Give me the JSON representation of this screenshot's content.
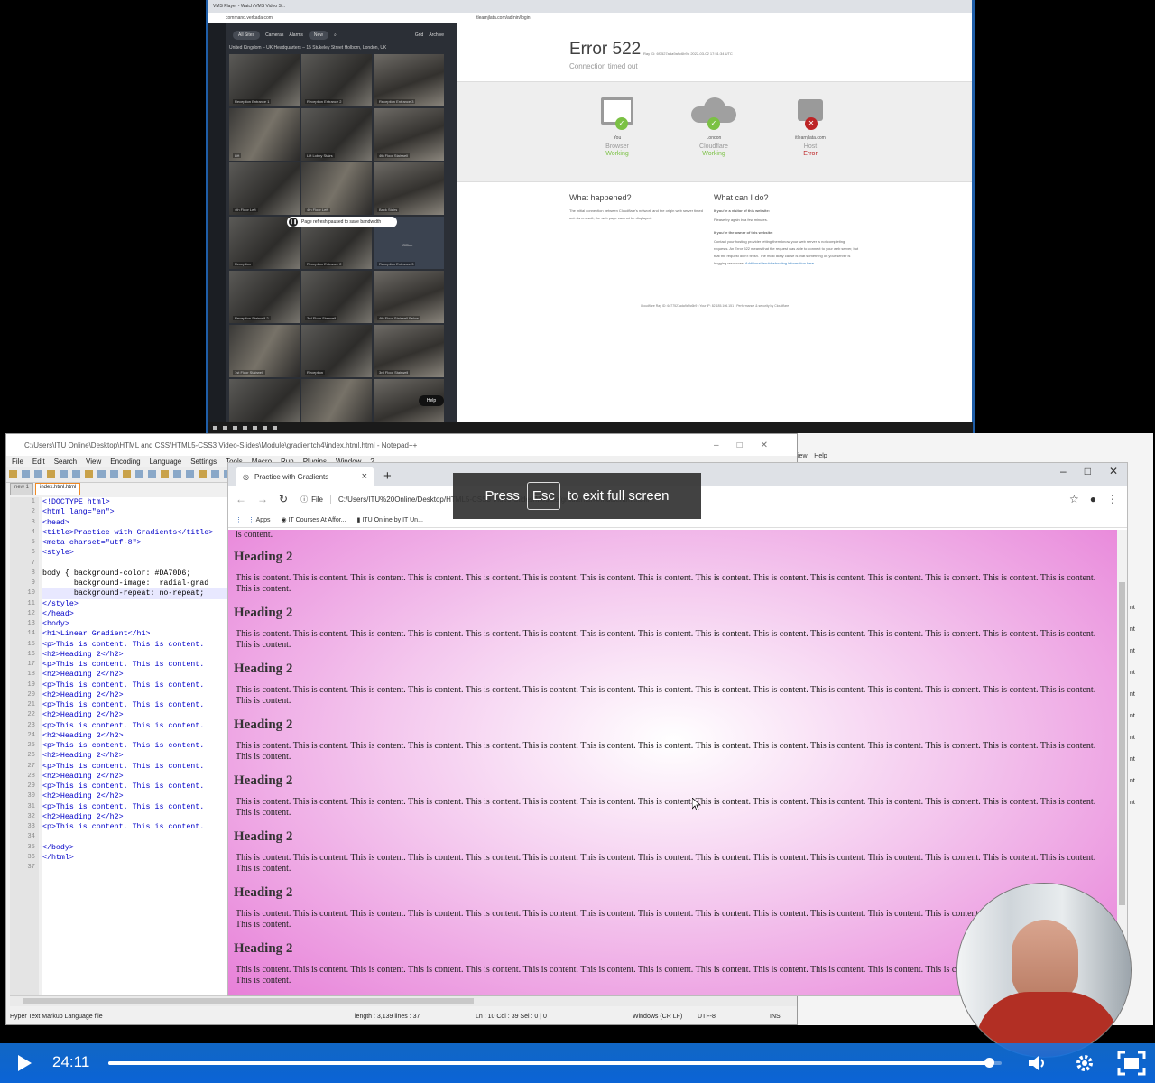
{
  "top": {
    "vms": {
      "tab_title": "VMS Player - Watch VMS Video S...",
      "address": "command.verkada.com",
      "nav": [
        "All Sites",
        "Cameras",
        "Alarms",
        "Grid",
        "Archive"
      ],
      "nav_badge": "New",
      "location": "United Kingdom – UK Headquarters – 15 Stukeley Street Holborn, London, UK",
      "cameras": [
        "Reception Entrance 1",
        "Reception Entrance 2",
        "Reception Entrance 3",
        "Lift",
        "Lift Lobby Stairs",
        "4th Floor Stairwell",
        "4th Floor Left",
        "4th Floor Left",
        "Back Stairs",
        "Reception",
        "Reception Entrance 2",
        "Reception Entrance 3",
        "Reception Stairwell 2",
        "3rd Floor Stairwell",
        "4th Floor Stairwell Below",
        "1st Floor Stairwell",
        "Reception",
        "3rd Floor Stairwell",
        "",
        "",
        ""
      ],
      "offline_label": "Offline",
      "pause_message": "Page refresh paused to save bandwidth",
      "help_label": "Help"
    },
    "cloudflare": {
      "address": "itlearnjlata.com/admin/login",
      "error_title": "Error 522",
      "ray": "Ray ID: 6f7527ada9a9c6b9 • 2022-03-02 17:51:34 UTC",
      "subtitle": "Connection timed out",
      "nodes": [
        {
          "label": "You",
          "name": "Browser",
          "status": "Working",
          "ok": true
        },
        {
          "label": "London",
          "name": "Cloudflare",
          "status": "Working",
          "ok": true
        },
        {
          "label": "itlearnjlata.com",
          "name": "Host",
          "status": "Error",
          "ok": false
        }
      ],
      "what_happened_title": "What happened?",
      "what_happened_text": "The initial connection between Cloudflare's network and the origin web server timed out. As a result, the web page can not be displayed.",
      "what_do_title": "What can I do?",
      "visitor_heading": "If you're a visitor of this website:",
      "visitor_text": "Please try again in a few minutes.",
      "owner_heading": "If you're the owner of this website:",
      "owner_text": "Contact your hosting provider letting them know your web server is not completing requests. An Error 522 means that the request was able to connect to your web server, but that the request didn't finish. The most likely cause is that something on your server is hogging resources.",
      "owner_link": "Additional troubleshooting information here.",
      "footer": "Cloudflare Ray ID: 6d77527ada9a9c6b9 • Your IP: 82.185.106.151 • Performance & security by Cloudflare"
    }
  },
  "npp": {
    "title": "C:\\Users\\ITU Online\\Desktop\\HTML and CSS\\HTML5-CSS3 Video-Slides\\Module\\gradientch4\\index.html.html - Notepad++",
    "menu": [
      "File",
      "Edit",
      "Search",
      "View",
      "Encoding",
      "Language",
      "Settings",
      "Tools",
      "Macro",
      "Run",
      "Plugins",
      "Window",
      "?"
    ],
    "tabs": [
      "new 1",
      "index.html.html"
    ],
    "code_lines": [
      "<!DOCTYPE html>",
      "<html lang=\"en\">",
      "<head>",
      "<title>Practice with Gradients</title>",
      "<meta charset=\"utf-8\">",
      "<style>",
      "",
      "body { background-color: #DA70D6;",
      "       background-image:  radial-grad",
      "       background-repeat: no-repeat;",
      "</style>",
      "</head>",
      "<body>",
      "<h1>Linear Gradient</h1>",
      "<p>This is content. This is content.",
      "<h2>Heading 2</h2>",
      "<p>This is content. This is content.",
      "<h2>Heading 2</h2>",
      "<p>This is content. This is content.",
      "<h2>Heading 2</h2>",
      "<p>This is content. This is content.",
      "<h2>Heading 2</h2>",
      "<p>This is content. This is content.",
      "<h2>Heading 2</h2>",
      "<p>This is content. This is content.",
      "<h2>Heading 2</h2>",
      "<p>This is content. This is content.",
      "<h2>Heading 2</h2>",
      "<p>This is content. This is content.",
      "<h2>Heading 2</h2>",
      "<p>This is content. This is content.",
      "<h2>Heading 2</h2>",
      "<p>This is content. This is content.",
      "",
      "</body>",
      "</html>",
      ""
    ],
    "status": {
      "type": "Hyper Text Markup Language file",
      "length": "length : 3,139    lines : 37",
      "pos": "Ln : 10    Col : 39    Sel : 0 | 0",
      "eol": "Windows (CR LF)",
      "enc": "UTF-8",
      "ins": "INS"
    },
    "bg_menu": [
      "iew",
      "Help"
    ],
    "bg_nt": "nt"
  },
  "browser": {
    "tab_title": "Practice with Gradients",
    "file_label": "File",
    "url": "C:/Users/ITU%20Online/Desktop/HTML5-CSS3 Video-Slides/Module/gradientch4/index.html.html",
    "bookmarks": [
      "Apps",
      "IT Courses At Affor...",
      "ITU Online by IT Un..."
    ],
    "top_fragment": "is content.",
    "heading": "Heading 2",
    "paragraph": "This is content. This is content. This is content. This is content. This is content. This is content. This is content. This is content. This is content. This is content. This is content. This is content. This is content. This is content. This is content. This is content.",
    "fullscreen_press": "Press",
    "fullscreen_key": "Esc",
    "fullscreen_rest": "to exit full screen"
  },
  "player": {
    "time": "24:11",
    "progress": 0.986
  },
  "colors": {
    "page_bg": "#DA70D6",
    "player_blue": "#0b64d6",
    "ok_green": "#7bc144",
    "err_red": "#bd2426"
  }
}
